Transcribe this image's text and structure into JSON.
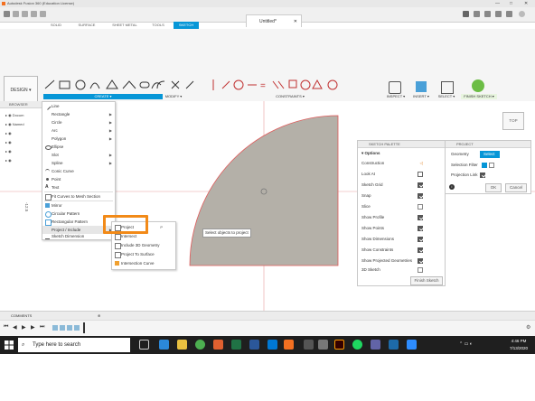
{
  "window": {
    "title": "Autodesk Fusion 360 (Education License)"
  },
  "document_tab": {
    "name": "Untitled*"
  },
  "workspace_tabs": [
    "SOLID",
    "SURFACE",
    "SHEET METAL",
    "TOOLS",
    "SKETCH"
  ],
  "workspace_active": "SKETCH",
  "toolbar": {
    "design_label": "DESIGN",
    "groups": {
      "create": "CREATE",
      "modify": "MODIFY",
      "constraints": "CONSTRAINTS",
      "inspect": "INSPECT",
      "insert": "INSERT",
      "select": "SELECT",
      "finish": "FINISH SKETCH"
    }
  },
  "browser": {
    "title": "BROWSER",
    "items": [
      "Docum",
      "Named",
      "",
      "",
      "",
      ""
    ]
  },
  "create_menu": {
    "items": [
      {
        "label": "Line",
        "submenu": false
      },
      {
        "label": "Rectangle",
        "submenu": true
      },
      {
        "label": "Circle",
        "submenu": true
      },
      {
        "label": "Arc",
        "submenu": true
      },
      {
        "label": "Polygon",
        "submenu": true
      },
      {
        "label": "Ellipse",
        "submenu": false
      },
      {
        "label": "Slot",
        "submenu": true
      },
      {
        "label": "Spline",
        "submenu": true
      },
      {
        "label": "Conic Curve",
        "submenu": false
      },
      {
        "label": "Point",
        "submenu": false
      },
      {
        "label": "Text",
        "submenu": false
      },
      {
        "label": "Fit Curves to Mesh Section",
        "submenu": false
      },
      {
        "label": "Mirror",
        "submenu": false
      },
      {
        "label": "Circular Pattern",
        "submenu": false
      },
      {
        "label": "Rectangular Pattern",
        "submenu": false
      },
      {
        "label": "Project / Include",
        "submenu": true
      },
      {
        "label": "Sketch Dimension",
        "submenu": false
      }
    ]
  },
  "project_submenu": {
    "items": [
      "Project",
      "Intersect",
      "Include 3D Geometry",
      "Project To Surface",
      "Intersection Curve"
    ],
    "shortcut": "P"
  },
  "canvas": {
    "tooltip": "Select objects to project",
    "axis_label": "-12.5"
  },
  "sketch_palette": {
    "title": "SKETCH PALETTE",
    "section": "Options",
    "rows": [
      {
        "label": "Construction",
        "kind": "icon"
      },
      {
        "label": "Look At",
        "kind": "icon"
      },
      {
        "label": "Sketch Grid",
        "checked": true
      },
      {
        "label": "Snap",
        "checked": true
      },
      {
        "label": "Slice",
        "checked": false
      },
      {
        "label": "Show Profile",
        "checked": true
      },
      {
        "label": "Show Points",
        "checked": true
      },
      {
        "label": "Show Dimensions",
        "checked": true
      },
      {
        "label": "Show Constraints",
        "checked": true
      },
      {
        "label": "Show Projected Geometries",
        "checked": true
      },
      {
        "label": "3D Sketch",
        "checked": false
      }
    ],
    "finish_label": "Finish Sketch"
  },
  "project_dialog": {
    "title": "PROJECT",
    "geometry_label": "Geometry",
    "select_label": "Select",
    "selection_filter_label": "Selection Filter",
    "projection_link_label": "Projection Link",
    "ok_label": "OK",
    "cancel_label": "Cancel"
  },
  "viewcube": {
    "label": "TOP"
  },
  "comments": {
    "label": "COMMENTS"
  },
  "taskbar": {
    "search_placeholder": "Type here to search",
    "time": "4:46 PM",
    "date": "7/13/2020"
  },
  "colors": {
    "accent": "#0696d7",
    "highlight": "#f28a18",
    "profile_fill": "#b4b0a8",
    "sketch_line": "#e05a5a"
  }
}
